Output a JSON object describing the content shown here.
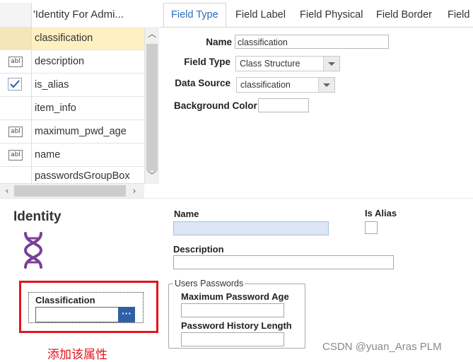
{
  "grid": {
    "header_title": "'Identity For Admi...",
    "rows": [
      {
        "label": "classification",
        "icon": "none",
        "selected": true
      },
      {
        "label": "description",
        "icon": "text-field-icon"
      },
      {
        "label": "is_alias",
        "icon": "checkbox-icon"
      },
      {
        "label": "item_info",
        "icon": "none"
      },
      {
        "label": "maximum_pwd_age",
        "icon": "text-field-icon"
      },
      {
        "label": "name",
        "icon": "text-field-icon"
      },
      {
        "label": "passwordsGroupBox",
        "icon": "none"
      }
    ],
    "text_icon_glyph": "abl"
  },
  "tabs": [
    "Field Type",
    "Field Label",
    "Field Physical",
    "Field Border",
    "Field C"
  ],
  "field_form": {
    "name_label": "Name",
    "name_value": "classification",
    "field_type_label": "Field Type",
    "field_type_value": "Class Structure",
    "data_source_label": "Data Source",
    "data_source_value": "classification",
    "bg_color_label": "Background Color",
    "bg_color_value": ""
  },
  "preview": {
    "title": "Identity",
    "name_label": "Name",
    "is_alias_label": "Is Alias",
    "description_label": "Description",
    "group_legend": "Users Passwords",
    "max_pwd_age_label": "Maximum Password Age",
    "pwd_history_label": "Password History Length",
    "classification_label": "Classification",
    "ellipsis": "···",
    "annotation": "添加该属性",
    "accent_color": "#7b3f98"
  },
  "watermark": "CSDN @yuan_Aras PLM"
}
